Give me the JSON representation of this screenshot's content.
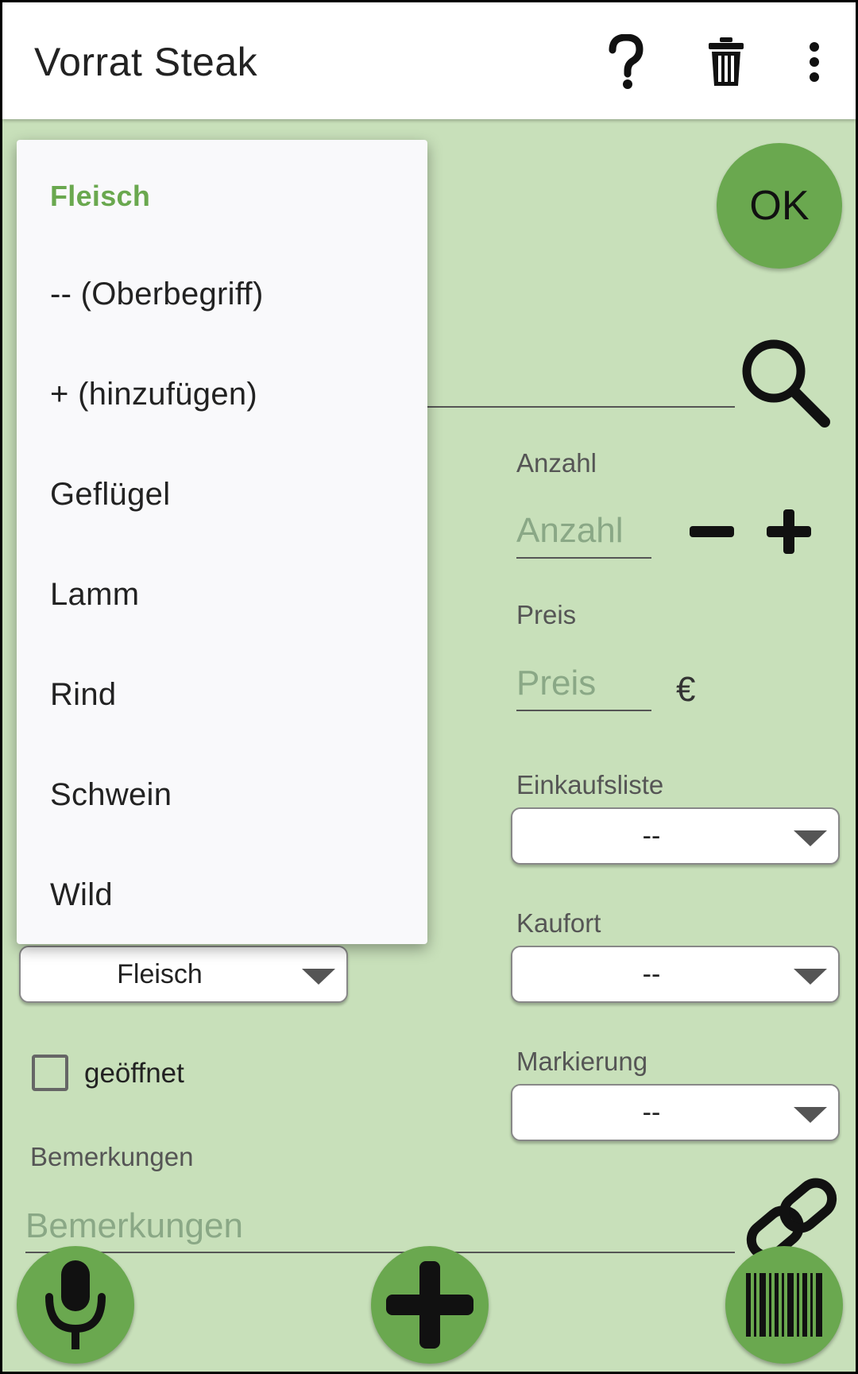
{
  "appbar": {
    "title": "Vorrat Steak",
    "icons": [
      "help-icon",
      "trash-icon",
      "more-vert-icon"
    ]
  },
  "ok_button": {
    "label": "OK"
  },
  "fields": {
    "anzahl": {
      "label": "Anzahl",
      "placeholder": "Anzahl"
    },
    "preis": {
      "label": "Preis",
      "placeholder": "Preis",
      "currency": "€"
    },
    "einkaufsliste": {
      "label": "Einkaufsliste",
      "value": "--"
    },
    "kaufort": {
      "label": "Kaufort",
      "value": "--"
    },
    "markierung": {
      "label": "Markierung",
      "value": "--"
    },
    "kategorie": {
      "value": "Fleisch"
    },
    "geoeffnet": {
      "label": "geöffnet",
      "checked": false
    },
    "bemerkungen": {
      "label": "Bemerkungen",
      "placeholder": "Bemerkungen"
    }
  },
  "dropdown": {
    "selected": "Fleisch",
    "items": [
      "-- (Oberbegriff)",
      "+ (hinzufügen)",
      "Geflügel",
      "Lamm",
      "Rind",
      "Schwein",
      "Wild"
    ]
  },
  "colors": {
    "accent": "#6aa84f",
    "background": "#c8e0ba"
  }
}
